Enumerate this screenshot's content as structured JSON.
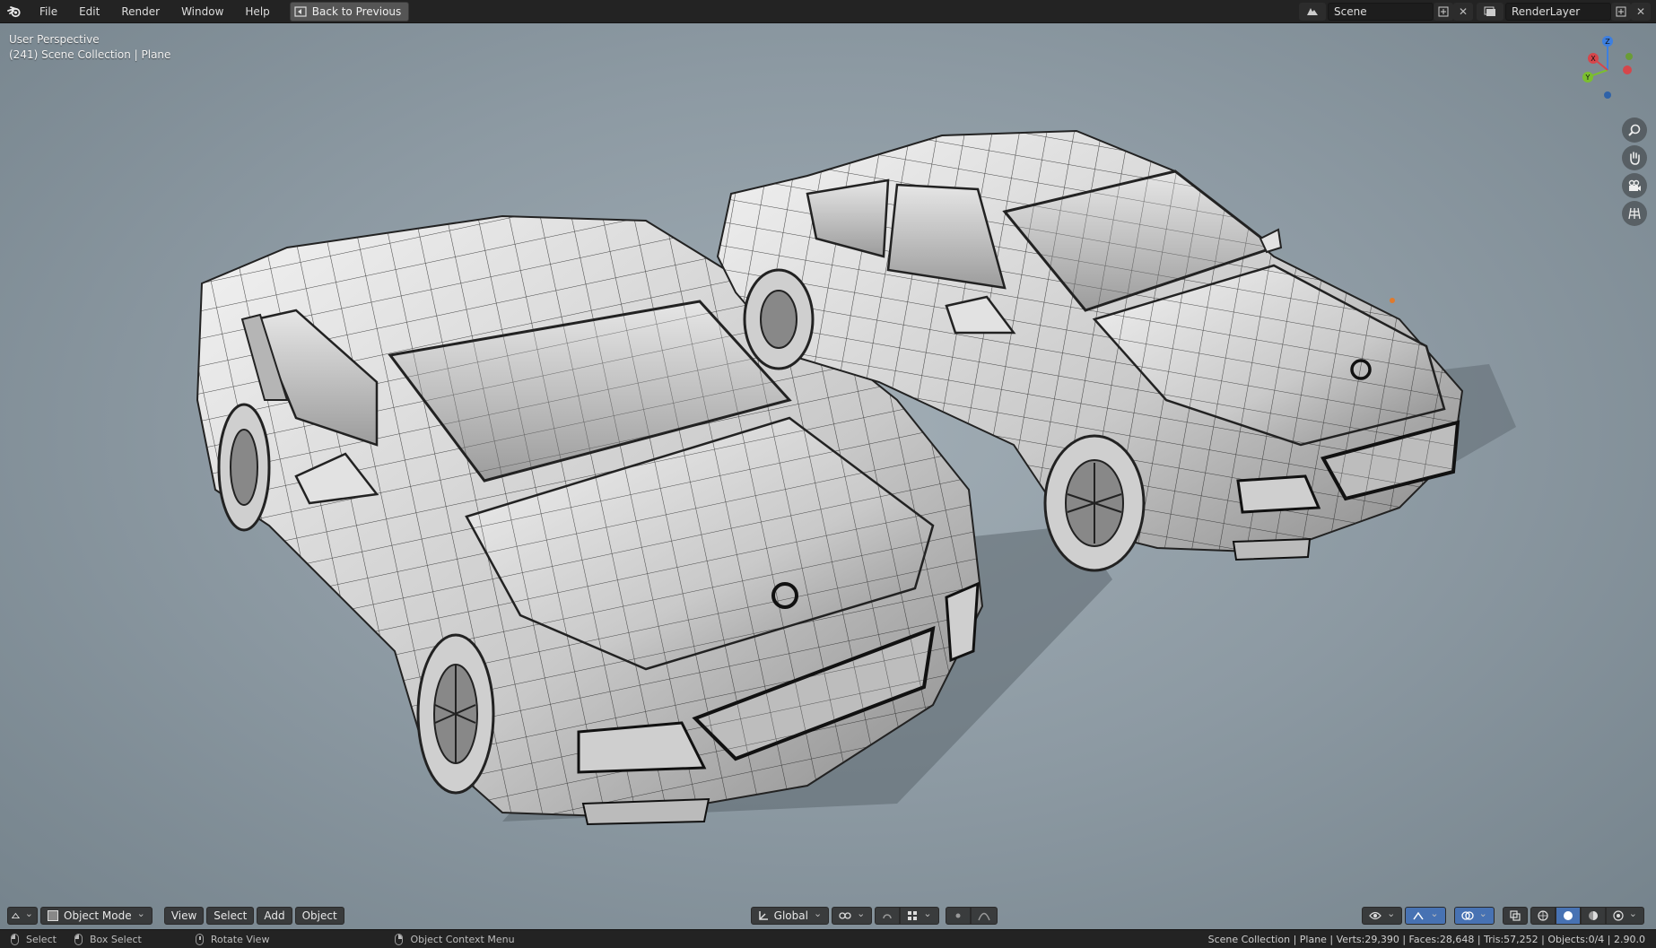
{
  "menu": {
    "items": [
      "File",
      "Edit",
      "Render",
      "Window",
      "Help"
    ],
    "back_button": "Back to Previous"
  },
  "scene_selector": {
    "value": "Scene"
  },
  "render_layer_selector": {
    "value": "RenderLayer"
  },
  "viewport": {
    "perspective": "User Perspective",
    "collection": "(241) Scene Collection | Plane",
    "gizmo_axes": [
      "X",
      "Y",
      "Z"
    ]
  },
  "header": {
    "mode": "Object Mode",
    "menus": [
      "View",
      "Select",
      "Add",
      "Object"
    ],
    "transform_orientation": "Global"
  },
  "status": {
    "select": "Select",
    "box_select": "Box Select",
    "rotate_view": "Rotate View",
    "context_menu": "Object Context Menu",
    "stats": "Scene Collection | Plane | Verts:29,390 | Faces:28,648 | Tris:57,252 | Objects:0/4 | 2.90.0"
  },
  "colors": {
    "axis_x": "#d6464b",
    "axis_y": "#7bbf2f",
    "axis_z": "#3d7fe0",
    "active_blue": "#4772b3"
  },
  "icons": [
    "blender-logo-icon",
    "back-icon",
    "scene-icon",
    "render-layer-icon",
    "zoom-icon",
    "hand-icon",
    "camera-icon",
    "grid-icon",
    "mode-icon",
    "pivot-icon",
    "snap-icon",
    "proportional-icon",
    "visibility-icon",
    "gizmo-icon",
    "overlay-icon",
    "xray-icon",
    "shading-wire-icon",
    "shading-solid-icon",
    "shading-material-icon",
    "shading-render-icon"
  ]
}
